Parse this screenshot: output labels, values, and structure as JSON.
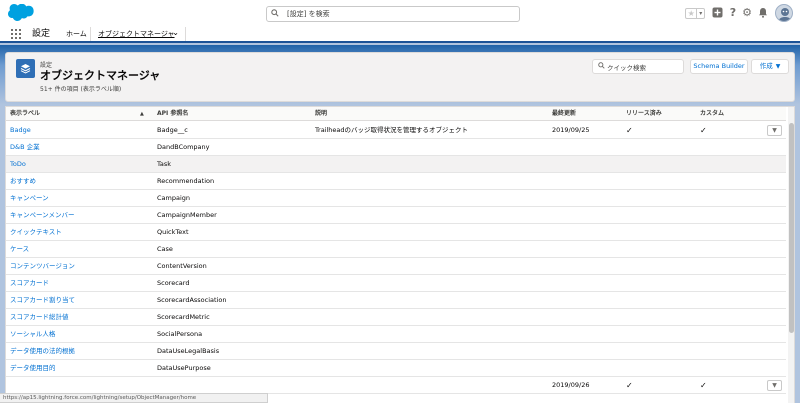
{
  "global_header": {
    "search_placeholder": "[設定] を検索",
    "icons": [
      "favorites-star-icon",
      "favorites-dropdown-icon",
      "add-icon",
      "help-icon",
      "setup-gear-icon",
      "notifications-bell-icon"
    ]
  },
  "nav": {
    "app_name": "設定",
    "home_label": "ホーム",
    "active_tab_label": "オブジェクトマネージャ"
  },
  "page_header": {
    "breadcrumb": "設定",
    "title": "オブジェクトマネージャ",
    "subtitle": "51+ 件の項目 (表示ラベル順)",
    "quick_search_placeholder": "クイック検索",
    "schema_builder_label": "Schema Builder",
    "new_label": "作成"
  },
  "table": {
    "columns": [
      "表示ラベル",
      "API 参照名",
      "説明",
      "最終更新",
      "リリース済み",
      "カスタム"
    ],
    "rows": [
      {
        "label": "Badge",
        "api": "Badge__c",
        "desc": "Trailheadのバッジ取得状況を管理するオブジェクト",
        "date": "2019/09/25",
        "deployed": "✓",
        "custom": "✓",
        "action": true
      },
      {
        "label": "D&B 企業",
        "api": "DandBCompany",
        "desc": "",
        "date": "",
        "deployed": "",
        "custom": "",
        "action": false
      },
      {
        "label": "ToDo",
        "api": "Task",
        "desc": "",
        "date": "",
        "deployed": "",
        "custom": "",
        "action": false
      },
      {
        "label": "おすすめ",
        "api": "Recommendation",
        "desc": "",
        "date": "",
        "deployed": "",
        "custom": "",
        "action": false
      },
      {
        "label": "キャンペーン",
        "api": "Campaign",
        "desc": "",
        "date": "",
        "deployed": "",
        "custom": "",
        "action": false
      },
      {
        "label": "キャンペーンメンバー",
        "api": "CampaignMember",
        "desc": "",
        "date": "",
        "deployed": "",
        "custom": "",
        "action": false
      },
      {
        "label": "クイックテキスト",
        "api": "QuickText",
        "desc": "",
        "date": "",
        "deployed": "",
        "custom": "",
        "action": false
      },
      {
        "label": "ケース",
        "api": "Case",
        "desc": "",
        "date": "",
        "deployed": "",
        "custom": "",
        "action": false
      },
      {
        "label": "コンテンツバージョン",
        "api": "ContentVersion",
        "desc": "",
        "date": "",
        "deployed": "",
        "custom": "",
        "action": false
      },
      {
        "label": "スコアカード",
        "api": "Scorecard",
        "desc": "",
        "date": "",
        "deployed": "",
        "custom": "",
        "action": false
      },
      {
        "label": "スコアカード割り当て",
        "api": "ScorecardAssociation",
        "desc": "",
        "date": "",
        "deployed": "",
        "custom": "",
        "action": false
      },
      {
        "label": "スコアカード総計値",
        "api": "ScorecardMetric",
        "desc": "",
        "date": "",
        "deployed": "",
        "custom": "",
        "action": false
      },
      {
        "label": "ソーシャル人格",
        "api": "SocialPersona",
        "desc": "",
        "date": "",
        "deployed": "",
        "custom": "",
        "action": false
      },
      {
        "label": "データ使用の法的根拠",
        "api": "DataUseLegalBasis",
        "desc": "",
        "date": "",
        "deployed": "",
        "custom": "",
        "action": false
      },
      {
        "label": "データ使用目的",
        "api": "DataUsePurpose",
        "desc": "",
        "date": "",
        "deployed": "",
        "custom": "",
        "action": false
      },
      {
        "label": "",
        "api": "",
        "desc": "",
        "date": "2019/09/26",
        "deployed": "✓",
        "custom": "✓",
        "action": true
      }
    ],
    "hover_row_index": 2
  },
  "status_url": "https://ap15.lightning.force.com/lightning/setup/ObjectManager/home",
  "colors": {
    "brand_blue": "#1b5297",
    "link_blue": "#0070d2",
    "icon_tile": "#2f6fb6"
  }
}
